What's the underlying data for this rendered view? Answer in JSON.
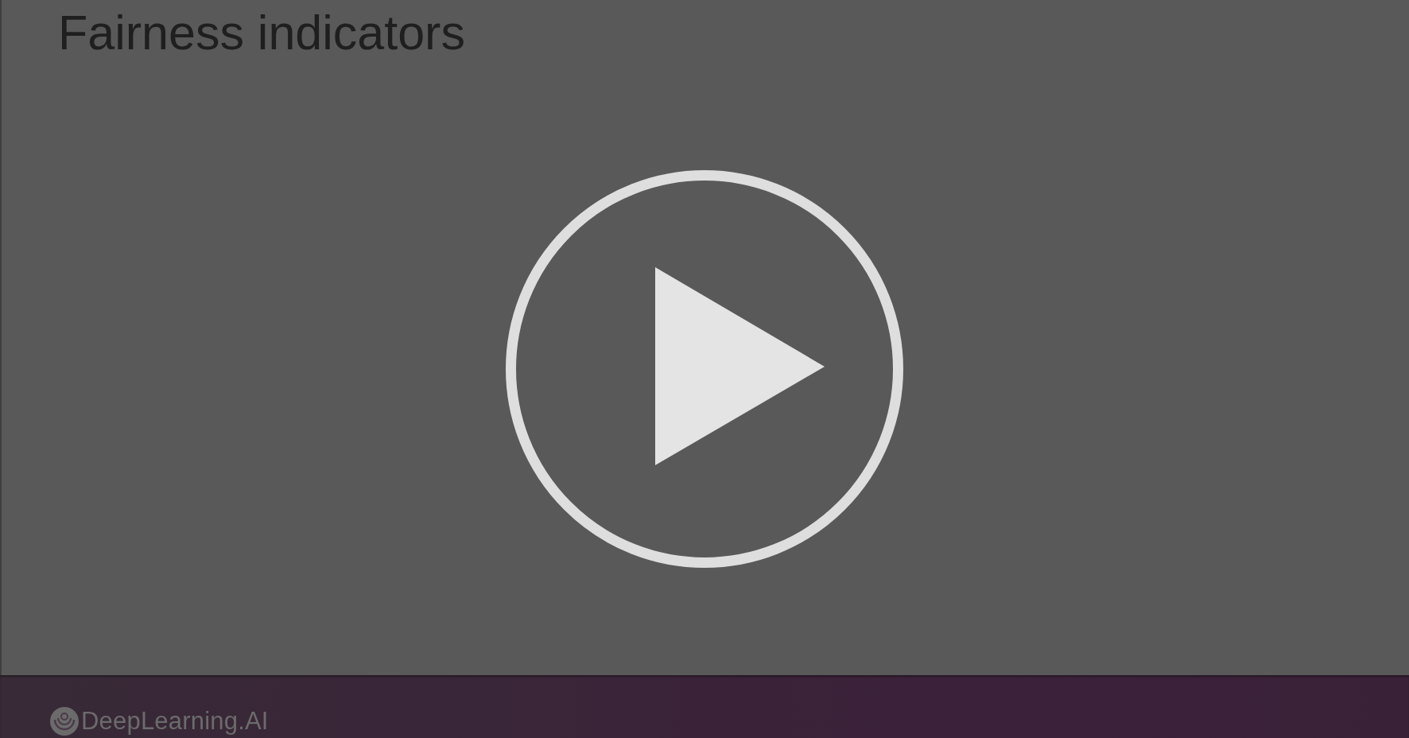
{
  "slide": {
    "title": "Fairness indicators"
  },
  "footer": {
    "brand": "DeepLearning.AI"
  }
}
